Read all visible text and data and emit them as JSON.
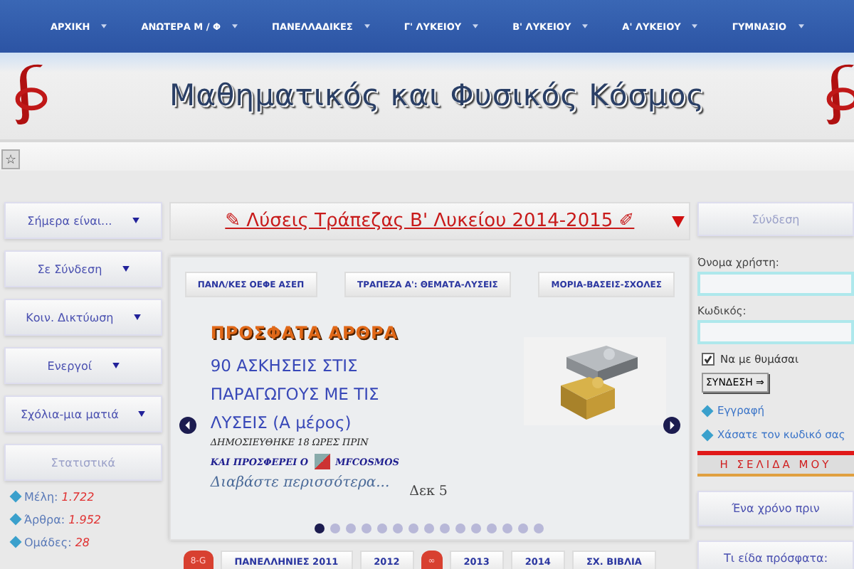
{
  "nav": [
    {
      "label": "ΑΡΧΙΚΗ"
    },
    {
      "label": "ΑΝΩΤΕΡΑ Μ / Φ"
    },
    {
      "label": "ΠΑΝΕΛΛΑΔΙΚΕΣ"
    },
    {
      "label": "Γ' ΛΥΚΕΙΟΥ"
    },
    {
      "label": "Β' ΛΥΚΕΙΟΥ"
    },
    {
      "label": "Α' ΛΥΚΕΙΟΥ"
    },
    {
      "label": "ΓΥΜΝΑΣΙΟ"
    }
  ],
  "header": {
    "title": "Μαθηματικός και Φυσικός Κόσμος"
  },
  "toolbar": {
    "star": "☆"
  },
  "left_sidebar": {
    "items": [
      {
        "label": "Σήμερα είναι...",
        "kind": "dropdown"
      },
      {
        "label": "Σε Σύνδεση",
        "kind": "dropdown"
      },
      {
        "label": "Κοιν. Δικτύωση",
        "kind": "dropdown"
      },
      {
        "label": "Ενεργοί",
        "kind": "dropdown"
      },
      {
        "label": "Σχόλια-μια ματιά",
        "kind": "dropdown"
      },
      {
        "label": "Στατιστικά",
        "kind": "plain"
      }
    ],
    "stats": [
      {
        "label": "Μέλη:",
        "value": "1.722"
      },
      {
        "label": "Άρθρα:",
        "value": "1.952"
      },
      {
        "label": "Ομάδες:",
        "value": "28"
      }
    ]
  },
  "banner": {
    "text": "✎ Λύσεις Τράπεζας Β' Λυκείου 2014-2015 ✐"
  },
  "tabs": [
    {
      "label": "ΠΑΝΛ/ΚΕΣ ΟΕΦΕ ΑΣΕΠ"
    },
    {
      "label": "ΤΡΑΠΕΖΑ Α': ΘΕΜΑΤΑ-ΛΥΣΕΙΣ"
    },
    {
      "label": "ΜΟΡΙΑ-ΒΑΣΕΙΣ-ΣΧΟΛΕΣ"
    }
  ],
  "slider": {
    "heading": "ΠΡΟΣΦΑΤΑ ΑΡΘΡΑ",
    "article_title": "90 ΑΣΚΗΣΕΙΣ ΣΤΙΣ ΠΑΡΑΓΩΓΟΥΣ ΜΕ ΤΙΣ ΛΥΣΕΙΣ (Α μέρος)",
    "published": "ΔΗΜΟΣΙΕΥΘΗΚΕ 18 ΩΡΕΣ ΠΡΙΝ",
    "offered_by": "ΚΑΙ ΠΡΟΣΦΕΡΕΙ Ο",
    "author": "MFCOSMOS",
    "read_more": "Διαβάστε περισσότερα...",
    "date": "Δεκ 5",
    "dots": [
      {
        "selected": true
      },
      {
        "selected": false
      },
      {
        "selected": false
      },
      {
        "selected": false
      },
      {
        "selected": false
      },
      {
        "selected": false
      },
      {
        "selected": false
      },
      {
        "selected": false
      },
      {
        "selected": false
      },
      {
        "selected": false
      },
      {
        "selected": false
      },
      {
        "selected": false
      },
      {
        "selected": false
      },
      {
        "selected": false
      },
      {
        "selected": false
      }
    ]
  },
  "bottom_links": [
    {
      "label": "8-G",
      "kind": "badge"
    },
    {
      "label": "ΠΑΝΕΛΛΗΝΙΕΣ 2011",
      "kind": "tab"
    },
    {
      "label": "2012",
      "kind": "tab"
    },
    {
      "label": "∞",
      "kind": "badge"
    },
    {
      "label": "2013",
      "kind": "tab"
    },
    {
      "label": "2014",
      "kind": "tab"
    },
    {
      "label": "ΣΧ. ΒΙΒΛΙΑ",
      "kind": "tab"
    }
  ],
  "right_sidebar": {
    "login_title": "Σύνδεση",
    "username_label": "Όνομα χρήστη:",
    "password_label": "Κωδικός:",
    "remember": {
      "label": "Να με θυμάσαι",
      "checked": true
    },
    "login_button": "ΣΥΝΔΕΣΗ ⇒",
    "links": [
      "Εγγραφή",
      "Χάσατε τον κωδικό σας"
    ],
    "my_page": "Η ΣΕΛΙΔΑ ΜΟΥ",
    "items": [
      {
        "label": "Ένα χρόνο πριν"
      },
      {
        "label": "Τι είδα πρόσφατα:"
      }
    ]
  }
}
